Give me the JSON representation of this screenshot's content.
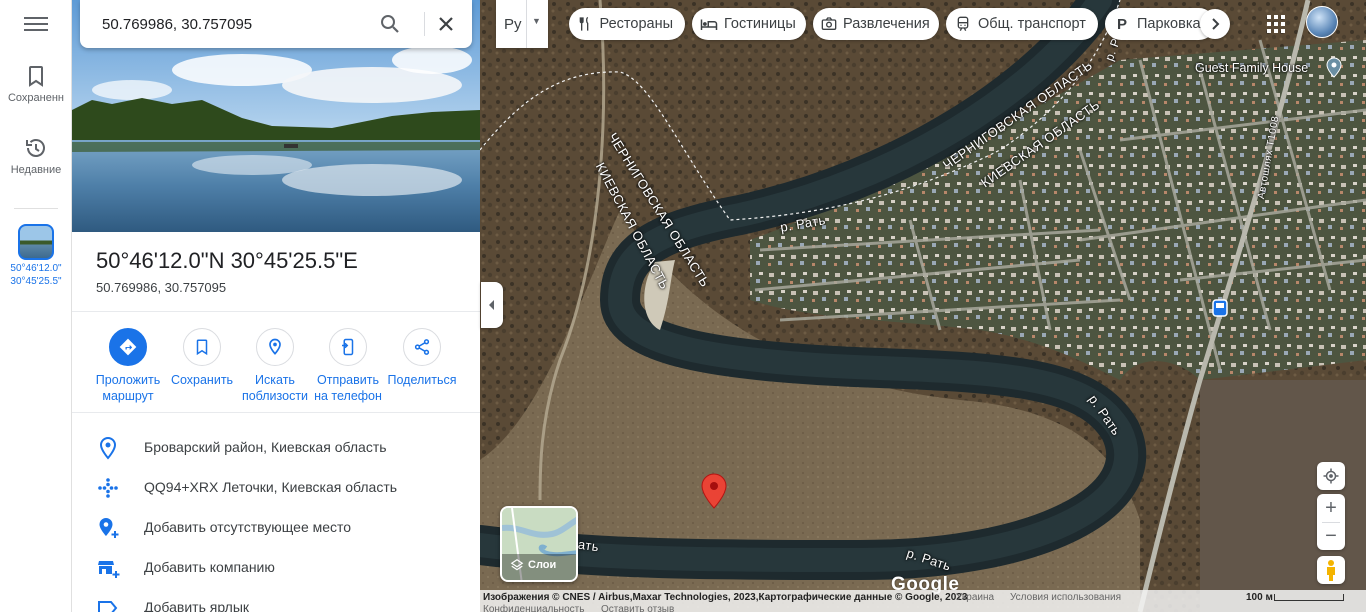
{
  "search": {
    "value": "50.769986, 30.757095",
    "search_icon": "search-icon",
    "close_icon": "close-icon"
  },
  "rail": {
    "menu_icon": "menu-icon",
    "items": [
      {
        "label": "Сохраненн",
        "icon": "bookmark-icon"
      },
      {
        "label": "Недавние",
        "icon": "history-icon"
      }
    ],
    "recent_label_line1": "50°46'12.0\"",
    "recent_label_line2": "30°45'25.5\""
  },
  "place": {
    "title": "50°46'12.0\"N 30°45'25.5\"E",
    "coords": "50.769986, 30.757095"
  },
  "actions": [
    {
      "label_line1": "Проложить",
      "label_line2": "маршрут",
      "icon": "directions-icon"
    },
    {
      "label_line1": "Сохранить",
      "label_line2": "",
      "icon": "bookmark-icon"
    },
    {
      "label_line1": "Искать",
      "label_line2": "поблизости",
      "icon": "nearby-icon"
    },
    {
      "label_line1": "Отправить",
      "label_line2": "на телефон",
      "icon": "send-to-phone-icon"
    },
    {
      "label_line1": "Поделиться",
      "label_line2": "",
      "icon": "share-icon"
    }
  ],
  "info_rows": [
    {
      "text": "Броварский район, Киевская область",
      "icon": "location-pin-icon"
    },
    {
      "text": "QQ94+XRX Леточки, Киевская область",
      "icon": "plus-code-icon"
    },
    {
      "text": "Добавить отсутствующее место",
      "icon": "add-place-icon"
    },
    {
      "text": "Добавить компанию",
      "icon": "add-business-icon"
    },
    {
      "text": "Добавить ярлык",
      "icon": "label-icon"
    }
  ],
  "map": {
    "lang_code": "Ру",
    "chips": [
      {
        "label": "Рестораны",
        "icon": "restaurant-icon"
      },
      {
        "label": "Гостиницы",
        "icon": "hotel-icon"
      },
      {
        "label": "Развлечения",
        "icon": "camera-icon"
      },
      {
        "label": "Общ. транспорт",
        "icon": "transit-icon"
      },
      {
        "label": "Парковка",
        "icon": "parking-icon"
      }
    ],
    "labels": {
      "region_chernigov_1": "ЧЕРНИГОВСКАЯ ОБЛАСТЬ",
      "region_kiev_1": "КИЕВСКАЯ ОБЛАСТЬ",
      "region_chernigov_2": "ЧЕРНИГОВСКАЯ ОБЛАСТЬ",
      "region_kiev_2": "КИЕВСКАЯ ОБЛАСТЬ",
      "river_1": "р. Рать",
      "river_2": "р. Рать",
      "river_3": "р. Рать",
      "river_4": "ать",
      "river_top": "р. Р",
      "road": "Автошлях Т1008",
      "poi": "Guest Family House"
    },
    "layers_label": "Слои",
    "logo": "Google",
    "footer": {
      "attribution": "Изображения © CNES / Airbus,Maxar Technologies, 2023,Картографические данные © Google, 2023",
      "country": "Украина",
      "terms": "Условия использования",
      "privacy": "Конфиденциальность",
      "feedback": "Оставить отзыв",
      "scale": "100 м"
    },
    "colors": {
      "pin": "#ea4335",
      "accent": "#1a73e8",
      "river": "#1e2a2e"
    }
  }
}
